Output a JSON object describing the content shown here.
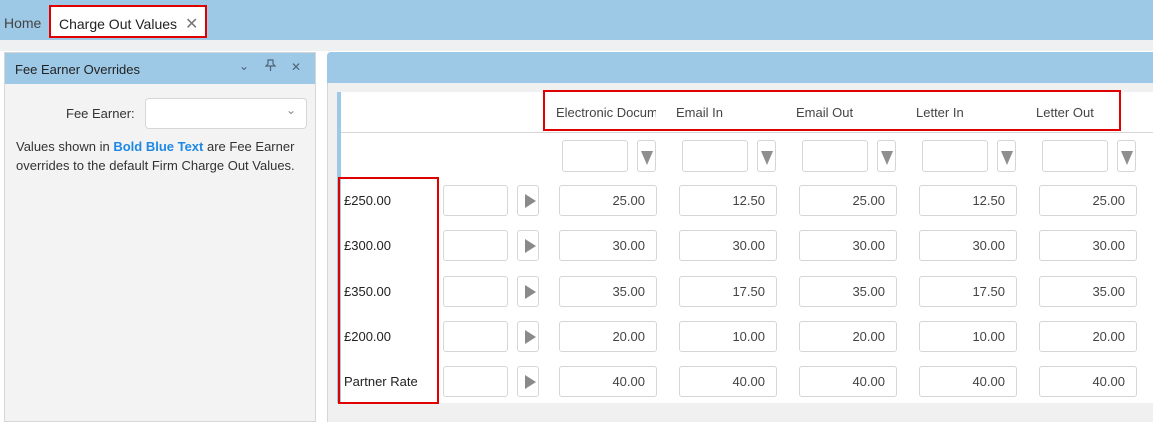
{
  "tabs": {
    "home_label": "Home",
    "active_label": "Charge Out Values",
    "close_glyph": "✕"
  },
  "left_panel": {
    "title": "Fee Earner Overrides",
    "icons": [
      "chevron-down-icon",
      "pin-icon",
      "close-icon"
    ],
    "fee_earner_label": "Fee Earner:",
    "fee_earner_value": "",
    "info_prefix": "Values shown in ",
    "info_highlight": "Bold Blue Text",
    "info_suffix": " are Fee Earner overrides to the default Firm Charge Out Values.",
    "highlight_color": "#1e88e5"
  },
  "grid": {
    "columns": [
      "Electronic Docum",
      "Email In",
      "Email Out",
      "Letter In",
      "Letter Out"
    ],
    "rows": [
      {
        "label": "£250.00",
        "values": [
          "25.00",
          "12.50",
          "25.00",
          "12.50",
          "25.00"
        ]
      },
      {
        "label": "£300.00",
        "values": [
          "30.00",
          "30.00",
          "30.00",
          "30.00",
          "30.00"
        ]
      },
      {
        "label": "£350.00",
        "values": [
          "35.00",
          "17.50",
          "35.00",
          "17.50",
          "35.00"
        ]
      },
      {
        "label": "£200.00",
        "values": [
          "20.00",
          "10.00",
          "20.00",
          "10.00",
          "20.00"
        ]
      },
      {
        "label": "Partner Rate",
        "values": [
          "40.00",
          "40.00",
          "40.00",
          "40.00",
          "40.00"
        ]
      }
    ]
  },
  "colors": {
    "header_blue": "#9ec9e6",
    "highlight_red": "#e00000"
  }
}
